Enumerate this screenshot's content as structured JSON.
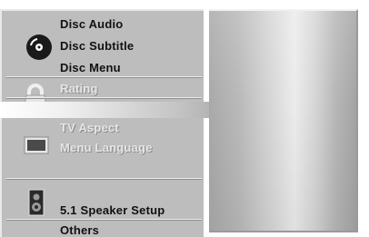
{
  "menu": {
    "disc_section": {
      "icon": "disc-icon",
      "items": [
        "Disc Audio",
        "Disc Subtitle",
        "Disc Menu"
      ]
    },
    "lock_section": {
      "icon": "lock-icon",
      "items": [
        "Rating"
      ]
    },
    "tv_section": {
      "icon": "tv-screen-icon",
      "items": [
        "TV Aspect",
        "Menu Language"
      ]
    },
    "speaker_section": {
      "icon": "speaker-icon",
      "items": [
        "5.1 Speaker Setup",
        "Others"
      ]
    }
  },
  "colors": {
    "panel": "#bdbdbd",
    "text": "#111111",
    "dim_text": "#e6e6e6",
    "preview_light": "#ececec",
    "preview_dark": "#a9a9a9"
  }
}
